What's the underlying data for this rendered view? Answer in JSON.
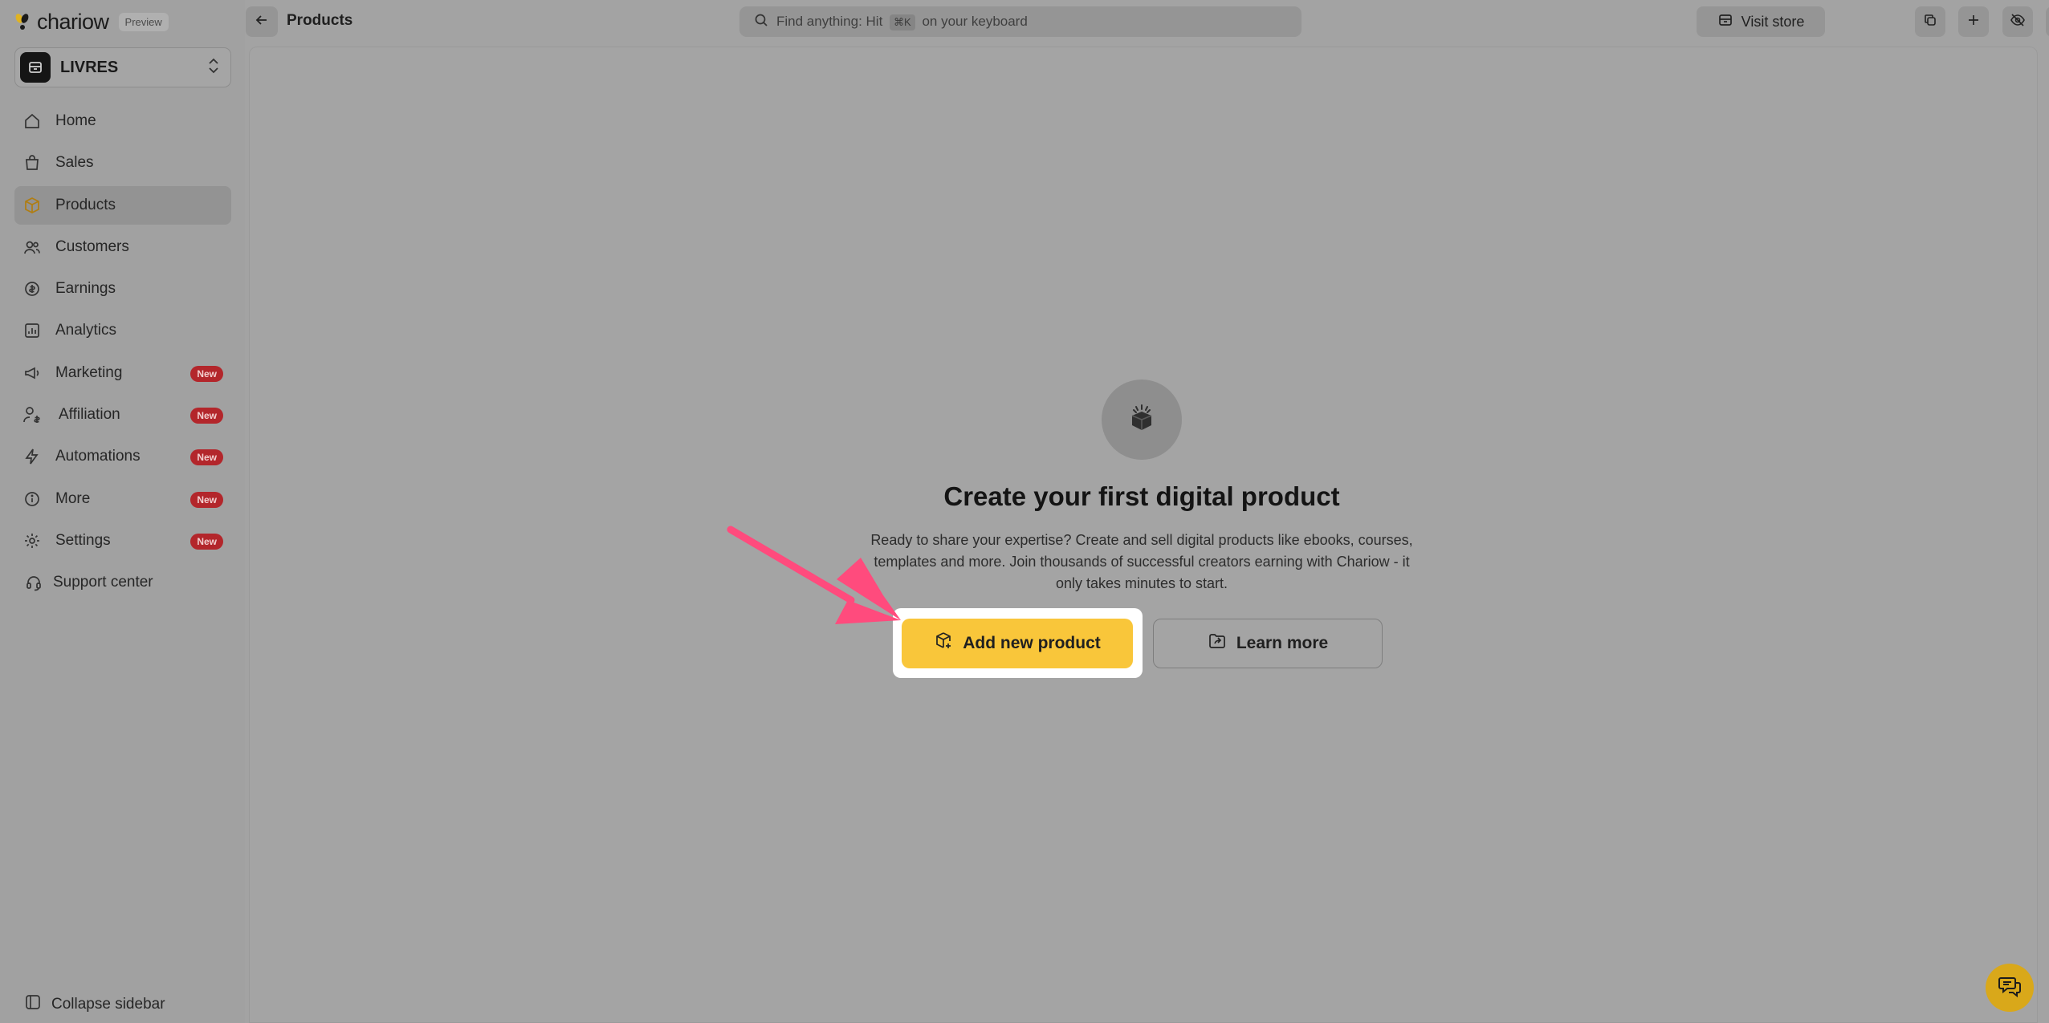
{
  "brand": {
    "name": "chariow",
    "tag": "Preview"
  },
  "store": {
    "name": "LIVRES"
  },
  "nav": {
    "items": [
      {
        "label": "Home",
        "icon": "home-icon"
      },
      {
        "label": "Sales",
        "icon": "shopping-bag-icon"
      },
      {
        "label": "Products",
        "icon": "package-icon",
        "active": true
      },
      {
        "label": "Customers",
        "icon": "users-icon"
      },
      {
        "label": "Earnings",
        "icon": "coins-icon"
      },
      {
        "label": "Analytics",
        "icon": "chart-icon"
      },
      {
        "label": "Marketing",
        "icon": "megaphone-icon",
        "badge": "New"
      },
      {
        "label": "Affiliation",
        "icon": "user-dollar-icon",
        "badge": "New"
      },
      {
        "label": "Automations",
        "icon": "lightning-icon",
        "badge": "New"
      },
      {
        "label": "More",
        "icon": "info-icon",
        "badge": "New"
      },
      {
        "label": "Settings",
        "icon": "gear-icon",
        "badge": "New"
      },
      {
        "label": "Support center",
        "icon": "headset-icon"
      }
    ],
    "collapse_label": "Collapse sidebar"
  },
  "topbar": {
    "title": "Products",
    "search_prefix": "Find anything: Hit",
    "search_kbd": "⌘K",
    "search_suffix": "on your keyboard",
    "visit_store": "Visit store"
  },
  "empty_state": {
    "title": "Create your first digital product",
    "description": "Ready to share your expertise? Create and sell digital products like ebooks, courses, templates and more. Join thousands of successful creators earning with Chariow - it only takes minutes to start.",
    "primary_label": "Add new product",
    "secondary_label": "Learn more"
  },
  "colors": {
    "accent": "#f9c63a",
    "badge": "#b3262b",
    "arrow": "#ff4b7d"
  }
}
